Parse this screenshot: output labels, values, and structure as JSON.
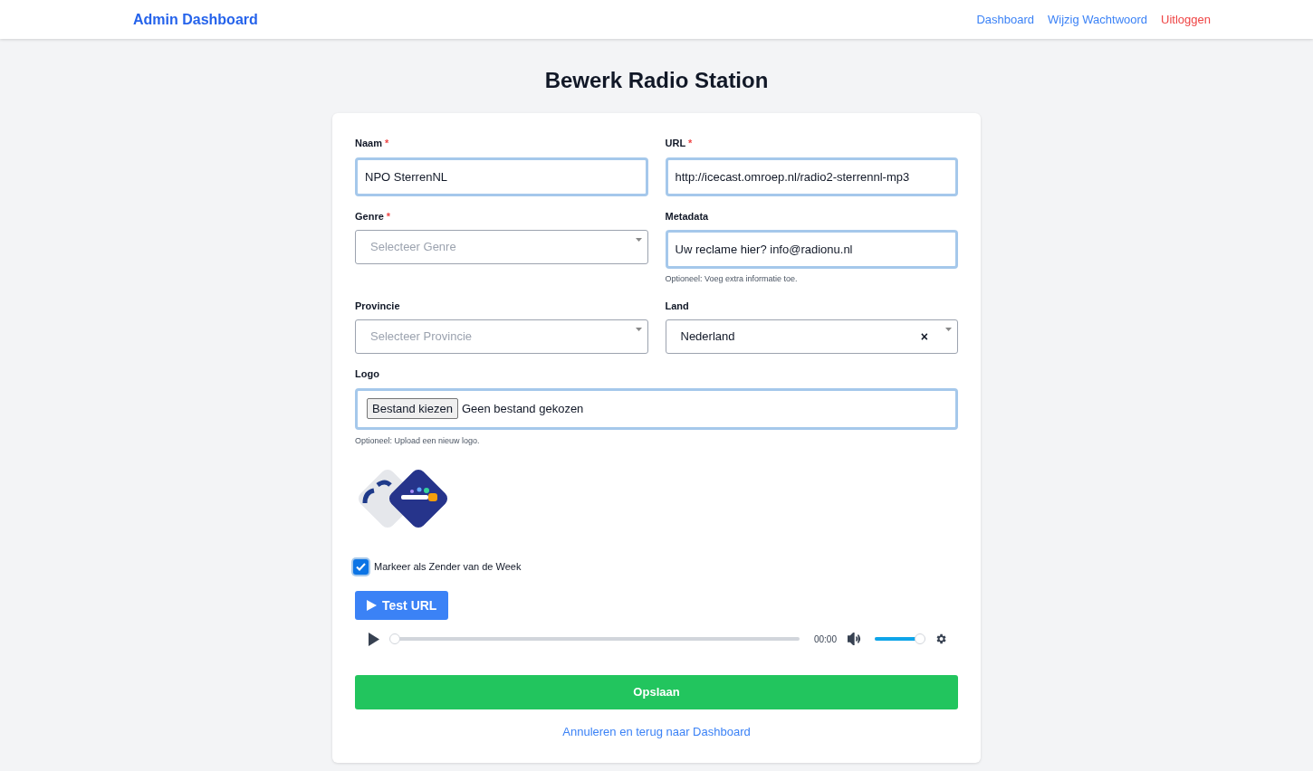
{
  "header": {
    "brand": "Admin Dashboard",
    "nav": [
      {
        "label": "Dashboard",
        "kind": "link"
      },
      {
        "label": "Wijzig Wachtwoord",
        "kind": "link"
      },
      {
        "label": "Uitloggen",
        "kind": "danger"
      }
    ]
  },
  "title": "Bewerk Radio Station",
  "fields": [
    {
      "kind": "text",
      "label": "Naam",
      "required_mark": "*",
      "value": "NPO SterrenNL",
      "highlighted": true
    },
    {
      "kind": "text",
      "label": "URL",
      "required_mark": "*",
      "value": "http://icecast.omroep.nl/radio2-sterrennl-mp3",
      "highlighted": true
    },
    {
      "kind": "select",
      "label": "Genre",
      "required_mark": "*",
      "placeholder": "Selecteer Genre"
    },
    {
      "kind": "text",
      "label": "Metadata",
      "value": "Uw reclame hier? info@radionu.nl",
      "highlighted": true,
      "help": "Optioneel: Voeg extra informatie toe."
    },
    {
      "kind": "select",
      "label": "Provincie",
      "placeholder": "Selecteer Provincie"
    },
    {
      "kind": "select",
      "label": "Land",
      "value": "Nederland",
      "clear": "×"
    }
  ],
  "logo": {
    "label": "Logo",
    "button": "Bestand kiezen",
    "status": "Geen bestand gekozen",
    "help": "Optioneel: Upload een nieuw logo.",
    "highlighted": true
  },
  "featured": {
    "label": "Markeer als Zender van de Week",
    "checked": true
  },
  "test_button": "Test URL",
  "player": {
    "progress": {
      "level": 0
    },
    "time": "00:00",
    "volume": {
      "level": 1
    }
  },
  "save_button": "Opslaan",
  "cancel_link": "Annuleren en terug naar Dashboard"
}
